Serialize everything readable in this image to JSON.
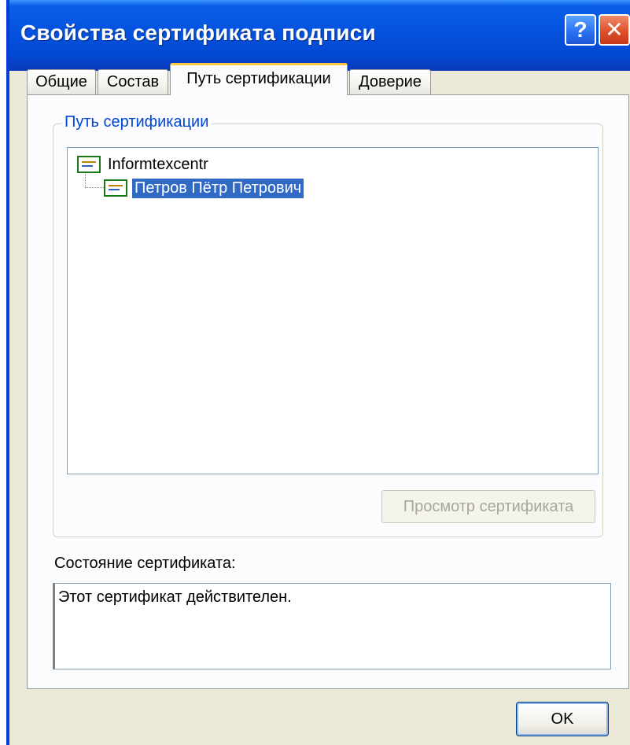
{
  "window": {
    "title": "Свойства сертификата подписи",
    "help_glyph": "?",
    "close_glyph": "✕"
  },
  "tabs": [
    {
      "label": "Общие",
      "active": false
    },
    {
      "label": "Состав",
      "active": false
    },
    {
      "label": "Путь сертификации",
      "active": true
    },
    {
      "label": "Доверие",
      "active": false
    }
  ],
  "certification_path": {
    "group_label": "Путь сертификации",
    "tree": [
      {
        "label": "Informtexcentr",
        "level": 0,
        "selected": false,
        "icon": "certificate-icon"
      },
      {
        "label": "Петров Пётр Петрович",
        "level": 1,
        "selected": true,
        "icon": "certificate-icon"
      }
    ],
    "view_button_label": "Просмотр сертификата",
    "view_button_enabled": false
  },
  "status": {
    "label": "Состояние сертификата:",
    "text": "Этот сертификат действителен."
  },
  "footer": {
    "ok_label": "OK"
  },
  "colors": {
    "titlebar": "#0554e0",
    "dialog_bg": "#ece9d8",
    "selection": "#316ac5",
    "group_label": "#0046d5",
    "active_tab_accent": "#ffc83c"
  }
}
